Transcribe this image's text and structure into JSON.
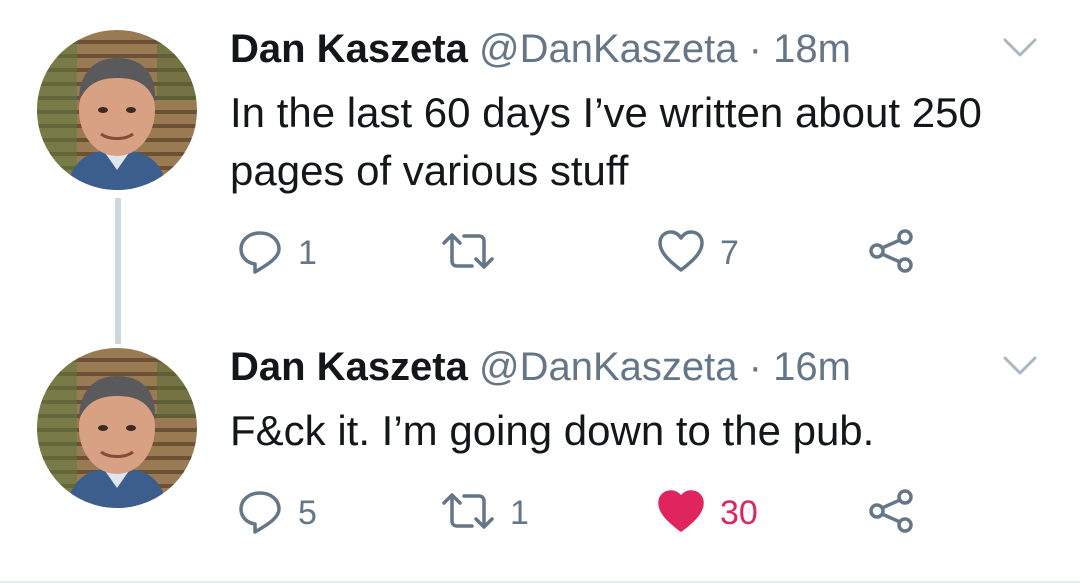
{
  "tweets": [
    {
      "name": "Dan Kaszeta",
      "handle": "@DanKaszeta",
      "separator": "·",
      "time": "18m",
      "text": "In the last 60 days I’ve written about 250 pages of various stuff",
      "reply_count": "1",
      "retweet_count": "",
      "like_count": "7",
      "liked": false
    },
    {
      "name": "Dan Kaszeta",
      "handle": "@DanKaszeta",
      "separator": "·",
      "time": "16m",
      "text": "F&ck it. I’m going down to the pub.",
      "reply_count": "5",
      "retweet_count": "1",
      "like_count": "30",
      "liked": true
    }
  ],
  "colors": {
    "text": "#14171a",
    "secondary": "#657786",
    "like_active": "#e0245e",
    "thread_line": "#ccd6dd",
    "border": "#e6ecf0"
  },
  "icons": {
    "reply": "reply-icon",
    "retweet": "retweet-icon",
    "like": "heart-icon",
    "share": "share-icon",
    "menu": "chevron-down-icon"
  }
}
